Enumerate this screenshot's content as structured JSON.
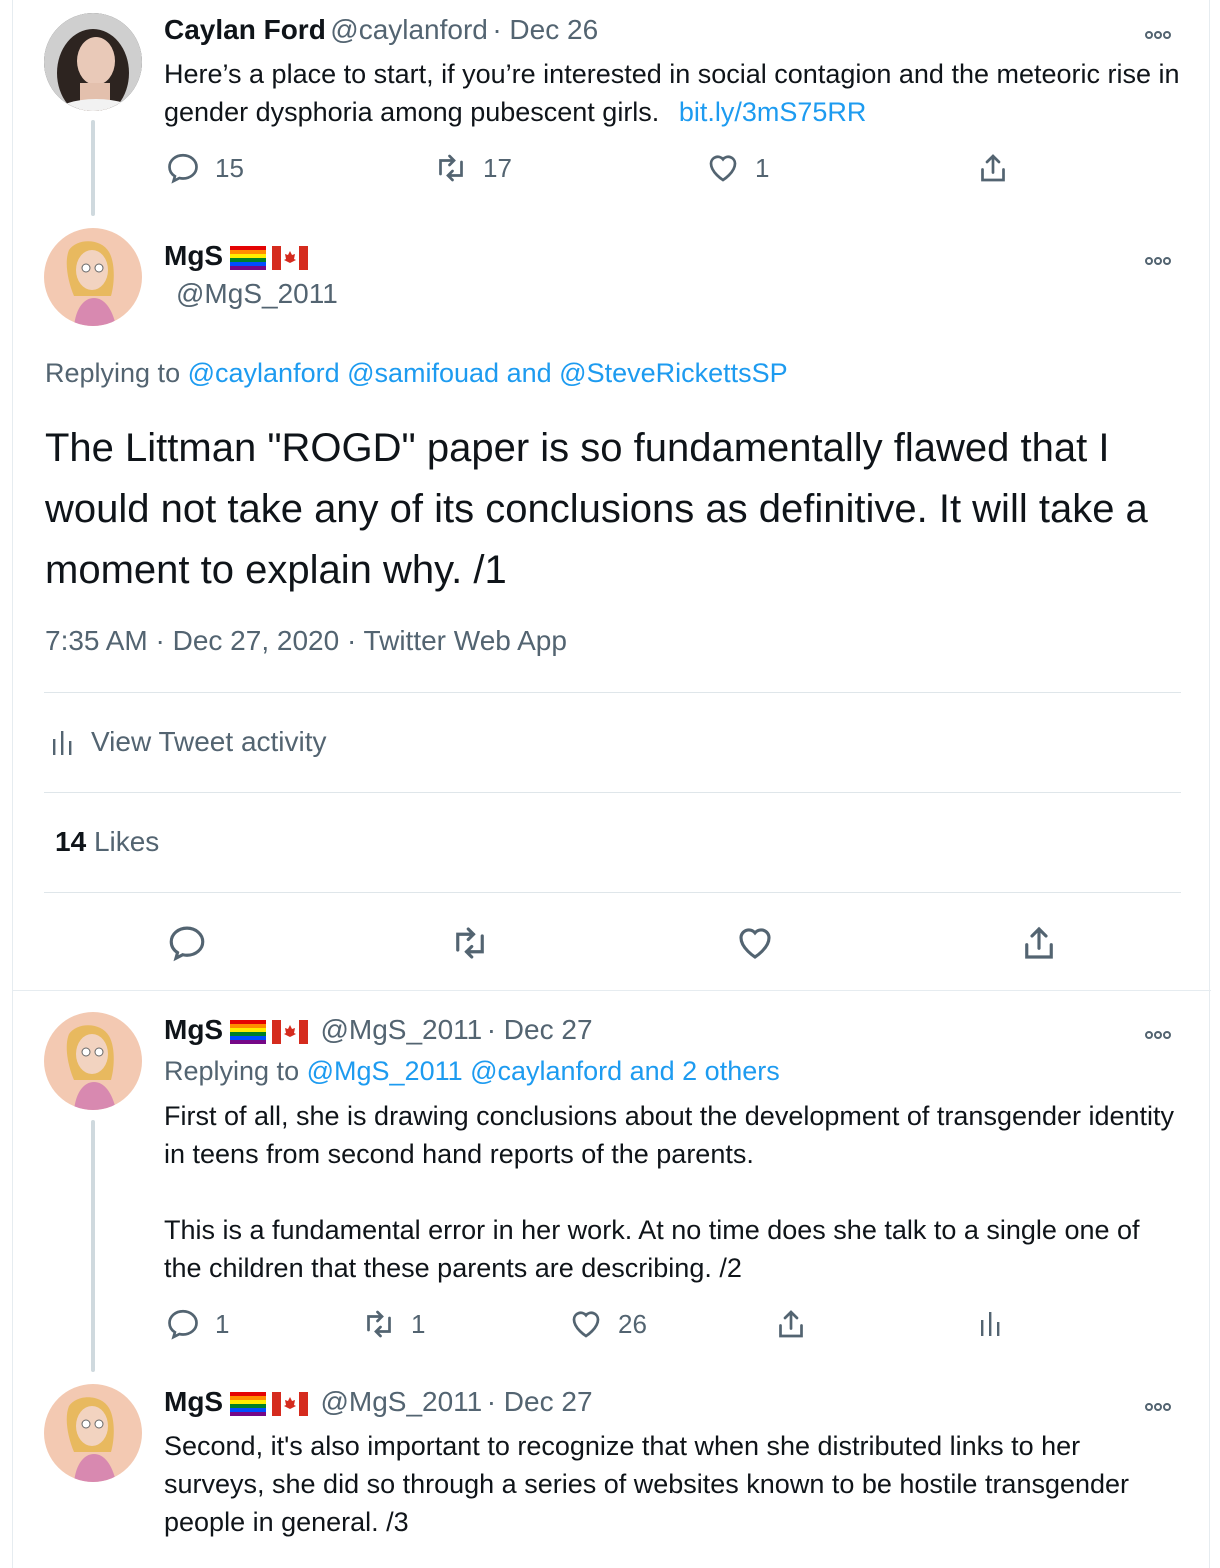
{
  "tweet1": {
    "name": "Caylan Ford",
    "handle": "@caylanford",
    "date": "· Dec 26",
    "text": "Here’s a place to start, if you’re interested in social contagion and the meteoric rise in gender dysphoria among pubescent girls.",
    "link": "bit.ly/3mS75RR",
    "replies": "15",
    "retweets": "17",
    "likes": "1"
  },
  "main": {
    "name": "MgS",
    "handle": "@MgS_2011",
    "replying_prefix": "Replying to",
    "replying_users": "@caylanford @samifouad",
    "replying_and": "and",
    "replying_last": "@SteveRickettsSP",
    "text": "The Littman \"ROGD\" paper is so fundamentally flawed that I would not take any of its conclusions as definitive. It will take a moment to explain why. /1",
    "meta": "7:35 AM · Dec 27, 2020 · Twitter Web App",
    "activity": "View Tweet activity",
    "likes_count": "14",
    "likes_label": "Likes"
  },
  "tweet2": {
    "name": "MgS",
    "handle": "@MgS_2011",
    "date": "· Dec 27",
    "replying_prefix": "Replying to",
    "replying_users": "@MgS_2011 @caylanford",
    "replying_rest": "and 2 others",
    "text1": "First of all, she is drawing conclusions about the development of transgender identity in teens from second hand reports of the parents.",
    "text2": "This is a fundamental error in her work. At no time does she talk to a single one of the children that these parents are describing. /2",
    "replies": "1",
    "retweets": "1",
    "likes": "26"
  },
  "tweet3": {
    "name": "MgS",
    "handle": "@MgS_2011",
    "date": "· Dec 27",
    "text": "Second, it's also important to recognize that when she distributed links to her surveys, she did so through a series of websites known to be hostile transgender people in general. /3"
  },
  "icons": {
    "reply": "reply-icon",
    "retweet": "retweet-icon",
    "like": "heart-icon",
    "share": "share-icon",
    "more": "more-icon",
    "activity": "bar-chart-icon"
  },
  "colors": {
    "link": "#1d9bf0",
    "muted": "#536471",
    "text": "#0f1419"
  }
}
